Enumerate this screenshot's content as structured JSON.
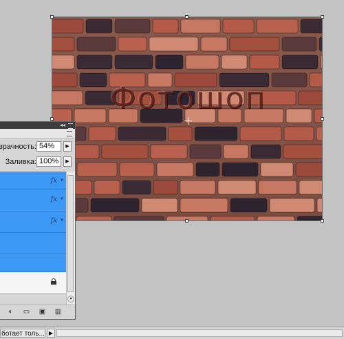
{
  "canvas": {
    "overlay_text": "Фотошоп",
    "image_description_icon": "brick-wall-image"
  },
  "layers_panel": {
    "opacity_label": "зрачность:",
    "opacity_value": "54%",
    "fill_label": "Заливка:",
    "fill_value": "100%",
    "layers": [
      {
        "fx": "fx"
      },
      {
        "fx": "fx"
      },
      {
        "fx": "fx"
      }
    ],
    "bottom_icons": [
      "adjustment-layer-icon",
      "folder-icon",
      "new-layer-icon",
      "trash-icon"
    ]
  },
  "statusbar": {
    "text": "ботает толь..."
  },
  "colors": {
    "selection_blue": "#3d97f5",
    "workspace_gray": "#c3c3c3"
  }
}
